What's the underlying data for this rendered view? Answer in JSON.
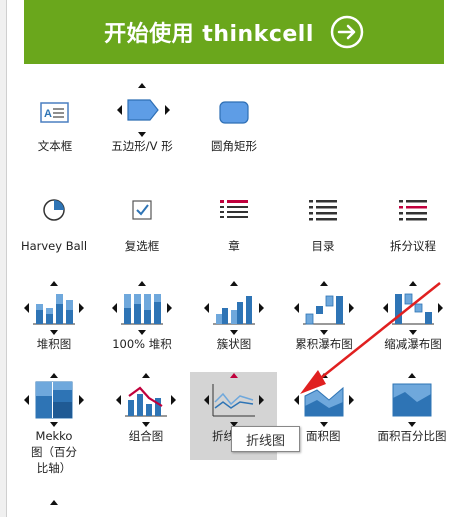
{
  "banner": {
    "title": "开始使用 thinkcell",
    "icon": "arrow-right-circle-icon",
    "color": "#6aa71c"
  },
  "row1": {
    "textbox": "文本框",
    "pentagon": "五边形/V 形",
    "rounded_rect": "圆角矩形"
  },
  "row2": {
    "harvey": "Harvey Ball",
    "checkbox": "复选框",
    "chapter": "章",
    "toc": "目录",
    "split": "拆分议程"
  },
  "row3": {
    "stacked": "堆积图",
    "stacked100": "100% 堆积",
    "clustered": "簇状图",
    "waterfall": "累积瀑布图",
    "waterfall_shrink": "缩减瀑布图"
  },
  "row4": {
    "mekko_l1": "Mekko",
    "mekko_l2": "图（百分",
    "mekko_l3": "比轴）",
    "combo": "组合图",
    "line": "折线图",
    "area": "面积图",
    "area100": "面积百分比图"
  },
  "tooltip": "折线图",
  "colors": {
    "accent_blue": "#2e74b5",
    "light_blue": "#6fa8dc",
    "red": "#c0003c"
  }
}
